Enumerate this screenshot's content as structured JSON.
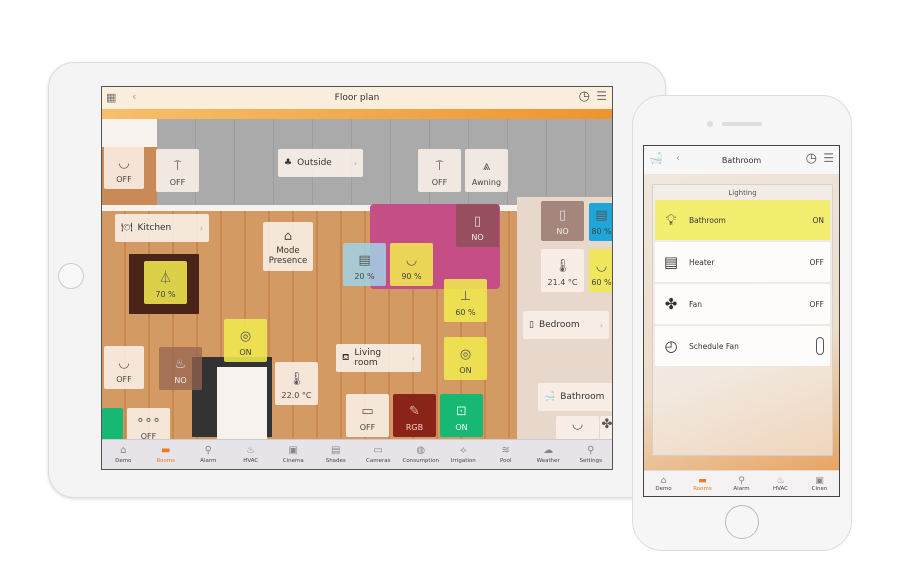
{
  "tablet": {
    "title": "Floor plan",
    "icons": {
      "floorplan": "floorplan-icon",
      "back": "chevron-left-icon",
      "history": "history-icon",
      "menu": "menu-icon"
    },
    "tiles": [
      {
        "label": "OFF",
        "icon": "ceiling-light"
      },
      {
        "label": "OFF",
        "icon": "switch"
      },
      {
        "label": "OFF",
        "icon": "switch"
      },
      {
        "label": "Awning",
        "icon": "awning"
      },
      {
        "label": "NO",
        "icon": "door-sensor"
      },
      {
        "label": "20 %",
        "icon": "shutter"
      },
      {
        "label": "90 %",
        "icon": "ceiling-light"
      },
      {
        "label": "70 %",
        "icon": "pendant-light"
      },
      {
        "label": "60 %",
        "icon": "floor-lamp"
      },
      {
        "label": "NO",
        "icon": "door-sensor"
      },
      {
        "label": "80 %",
        "icon": "shutter"
      },
      {
        "label": "21.4 °C",
        "icon": "thermometer"
      },
      {
        "label": "60 %",
        "icon": "ceiling-light"
      },
      {
        "label": "ON",
        "icon": "speaker"
      },
      {
        "label": "OFF",
        "icon": "ceiling-light"
      },
      {
        "label": "NO",
        "icon": "fire"
      },
      {
        "label": "ON",
        "icon": "speaker"
      },
      {
        "label": "22.0 °C",
        "icon": "thermometer"
      },
      {
        "label": "OFF",
        "icon": "air-conditioner"
      },
      {
        "label": "RGB",
        "icon": "color-picker"
      },
      {
        "label": "ON",
        "icon": "outlet"
      },
      {
        "label": "OFF",
        "icon": "light-strip"
      }
    ],
    "mode": {
      "line1": "Mode",
      "line2": "Presence"
    },
    "rooms": [
      "Outside",
      "Kitchen",
      "Living room",
      "Bedroom",
      "Bathroom"
    ],
    "nav": [
      {
        "label": "Demo",
        "icon": "home"
      },
      {
        "label": "Rooms",
        "icon": "rooms",
        "active": true
      },
      {
        "label": "Alarm",
        "icon": "wrench"
      },
      {
        "label": "HVAC",
        "icon": "fire"
      },
      {
        "label": "Cinema",
        "icon": "play"
      },
      {
        "label": "Shades",
        "icon": "shades"
      },
      {
        "label": "Cameras",
        "icon": "camera"
      },
      {
        "label": "Consumption",
        "icon": "meter"
      },
      {
        "label": "Irrigation",
        "icon": "sprinkler"
      },
      {
        "label": "Pool",
        "icon": "pool"
      },
      {
        "label": "Weather",
        "icon": "weather"
      },
      {
        "label": "Settings",
        "icon": "wrench"
      }
    ]
  },
  "phone": {
    "title": "Bathroom",
    "section": "Lighting",
    "rows": [
      {
        "label": "Bathroom",
        "value": "ON",
        "icon": "bulb"
      },
      {
        "label": "Heater",
        "value": "OFF",
        "icon": "heater"
      },
      {
        "label": "Fan",
        "value": "OFF",
        "icon": "fan"
      },
      {
        "label": "Schedule Fan",
        "icon": "schedule",
        "toggle": "off"
      }
    ],
    "nav": [
      {
        "label": "Demo",
        "icon": "home"
      },
      {
        "label": "Rooms",
        "icon": "rooms",
        "active": true
      },
      {
        "label": "Alarm",
        "icon": "wrench"
      },
      {
        "label": "HVAC",
        "icon": "fire"
      },
      {
        "label": "Cinen",
        "icon": "play"
      }
    ]
  },
  "colors": {
    "accent": "#f07a20",
    "on_yellow": "#f0e850",
    "green": "#16b873",
    "rgb_red": "#8a2418"
  }
}
